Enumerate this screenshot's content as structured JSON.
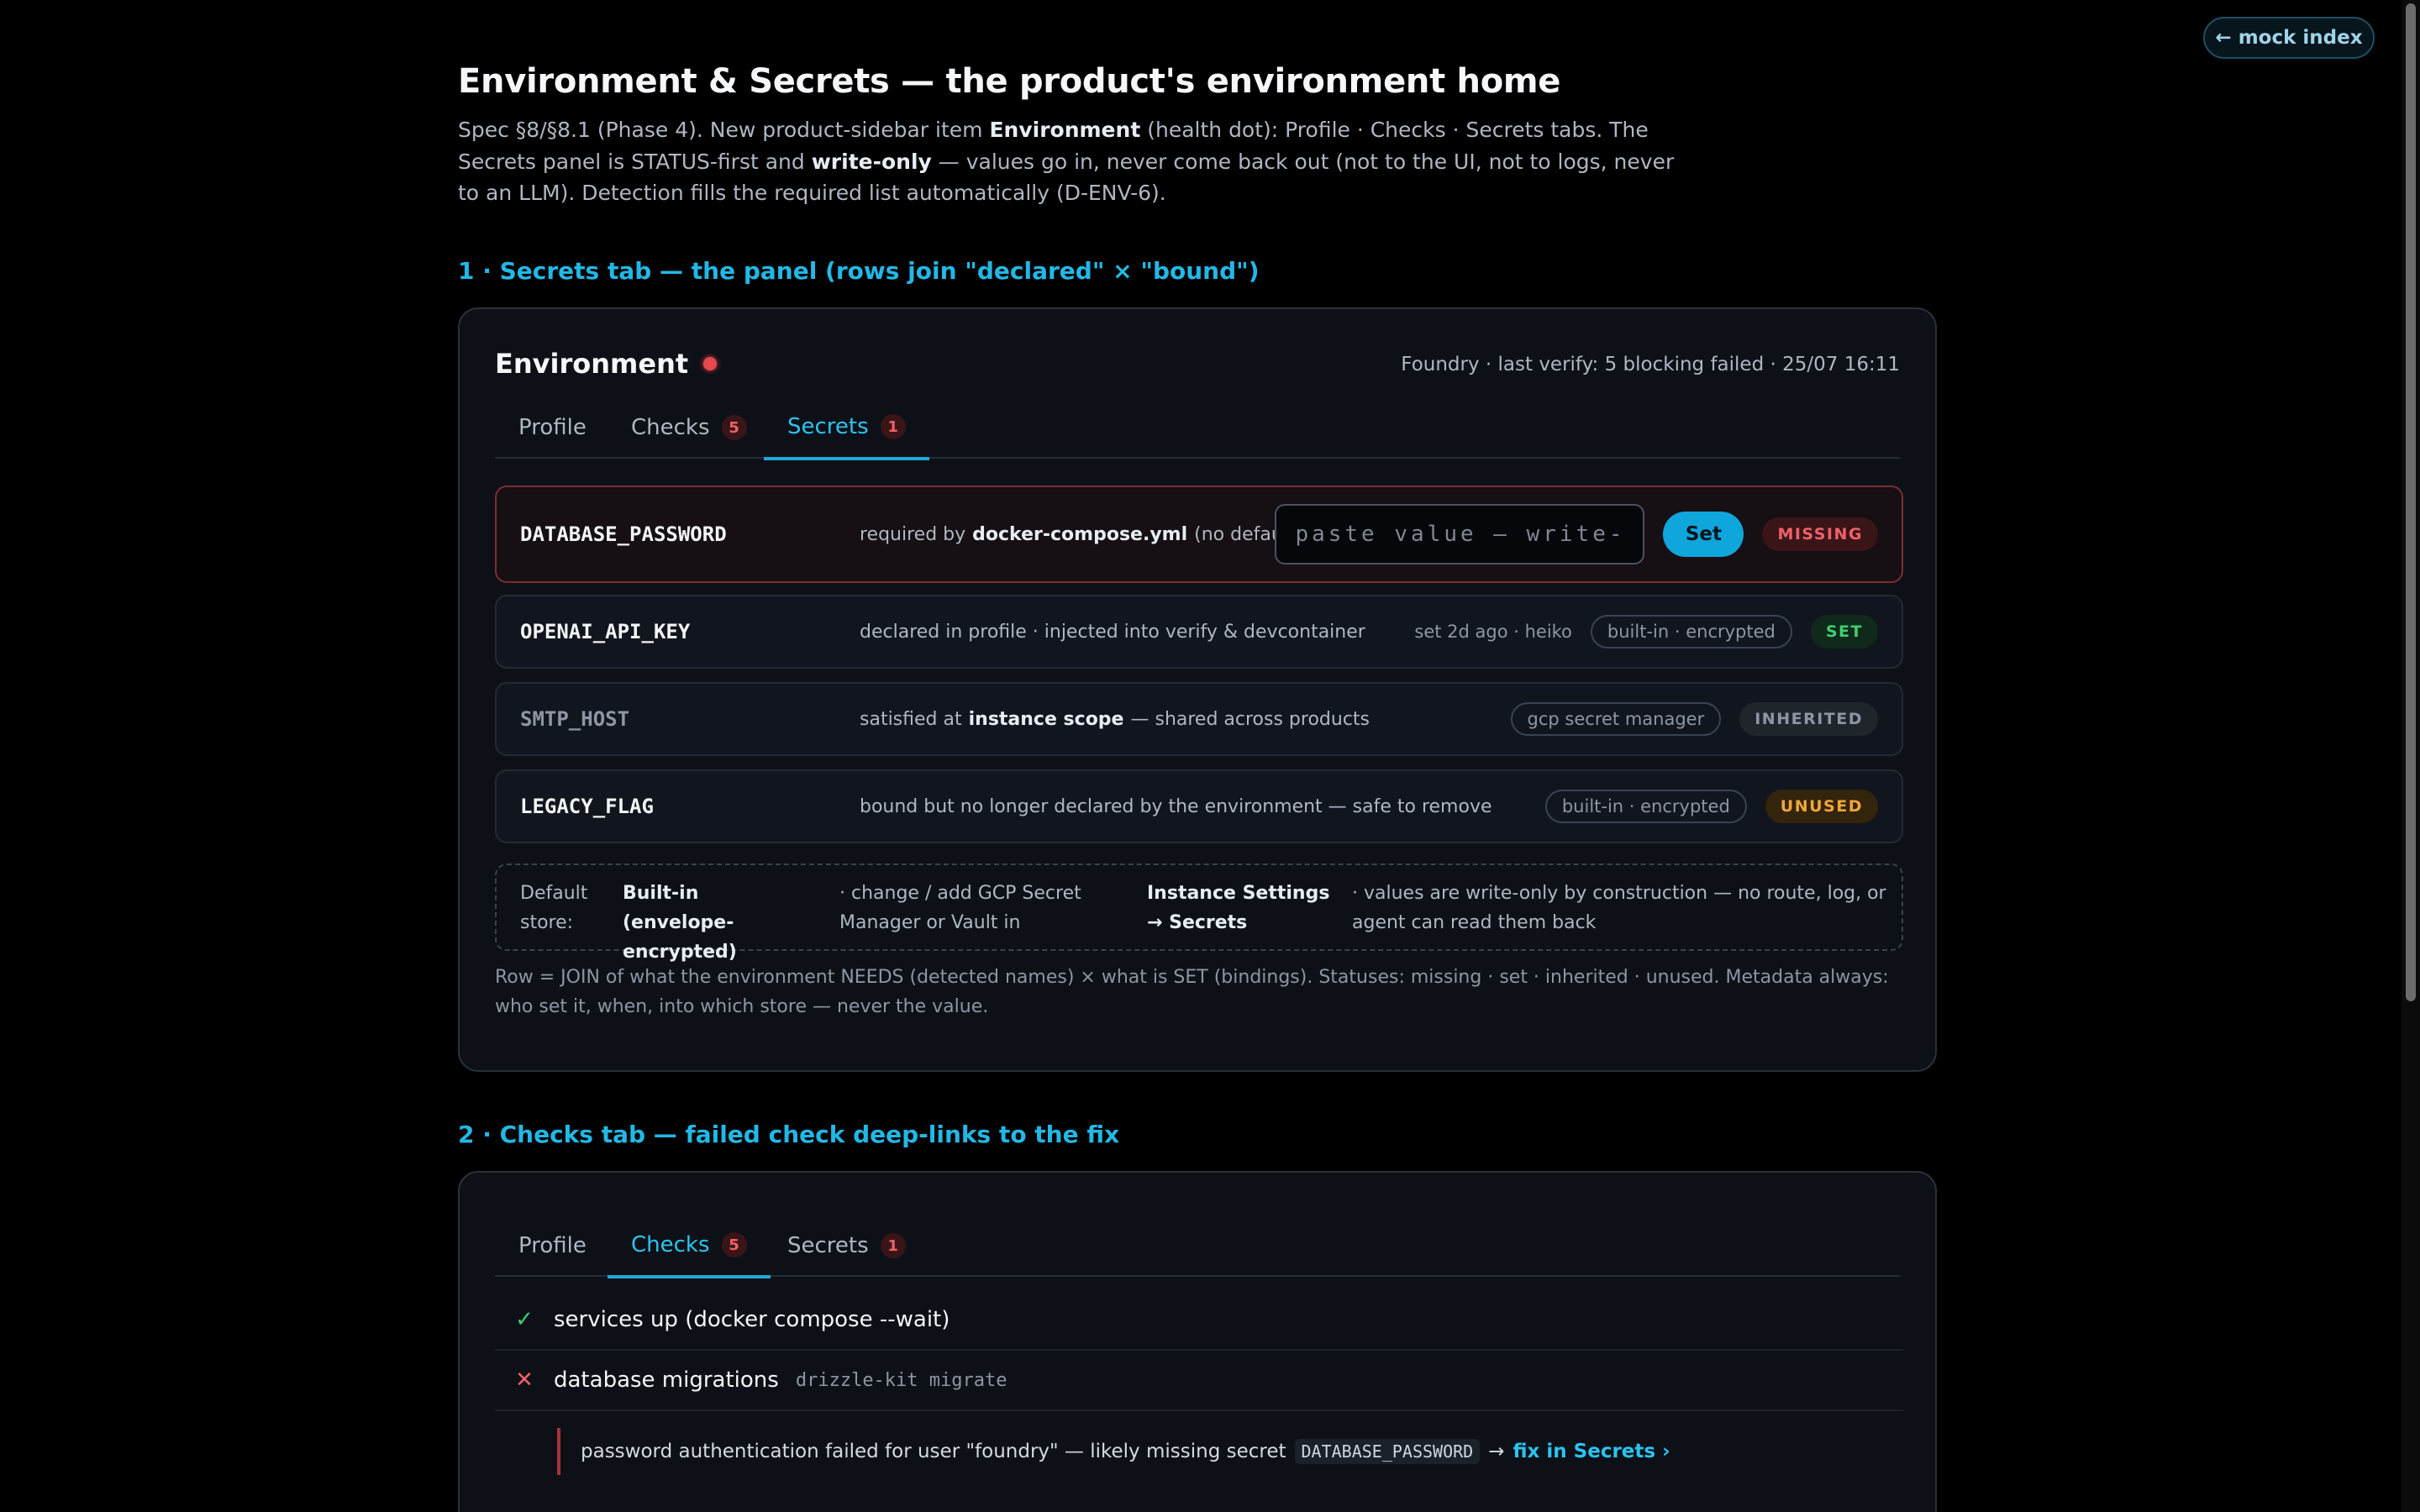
{
  "nav": {
    "mock_index": "← mock index"
  },
  "page": {
    "title": "Environment & Secrets — the product's environment home",
    "intro": {
      "p1": "Spec §8/§8.1 (Phase 4). New product-sidebar item ",
      "b1": "Environment",
      "p2": " (health dot): Profile · Checks · Secrets tabs. The Secrets panel is STATUS-first and ",
      "b2": "write-only",
      "p3": " — values go in, never come back out (not to the UI, not to logs, never to an LLM). Detection fills the required list automatically (D-ENV-6)."
    }
  },
  "sections": {
    "secrets_heading": "1 · Secrets tab — the panel (rows join \"declared\" × \"bound\")",
    "checks_heading": "2 · Checks tab — failed check deep-links to the fix"
  },
  "panel": {
    "title": "Environment",
    "meta": "Foundry · last verify: 5 blocking failed · 25/07 16:11",
    "tabs": [
      {
        "label": "Profile",
        "badge": ""
      },
      {
        "label": "Checks",
        "badge": "5"
      },
      {
        "label": "Secrets",
        "badge": "1"
      }
    ],
    "secrets": [
      {
        "name": "DATABASE_PASSWORD",
        "desc_pre": "required by",
        "desc_bold": "docker-compose.yml",
        "desc_post": "(no default)",
        "input_placeholder": "paste value — write-only",
        "button": "Set",
        "status": "MISSING"
      },
      {
        "name": "OPENAI_API_KEY",
        "desc": "declared in profile · injected into verify & devcontainer",
        "meta": "set 2d ago · heiko",
        "store": "built-in · encrypted",
        "status": "SET"
      },
      {
        "name": "SMTP_HOST",
        "desc_pre": "satisfied at",
        "desc_bold": "instance scope",
        "desc_post": "— shared across products",
        "store": "gcp secret manager",
        "status": "INHERITED"
      },
      {
        "name": "LEGACY_FLAG",
        "desc": "bound but no longer declared by the environment — safe to remove",
        "store": "built-in · encrypted",
        "status": "UNUSED"
      }
    ],
    "store_box": {
      "label": "Default store:",
      "store": "Built-in (envelope-encrypted)",
      "middle": "· change / add GCP Secret Manager or Vault in",
      "link": "Instance Settings → Secrets",
      "tail": "· values are write-only by construction — no route, log, or agent can read them back"
    },
    "note": "Row = JOIN of what the environment NEEDS (detected names) × what is SET (bindings). Statuses: missing · set · inherited · unused. Metadata always: who set it, when, into which store — never the value."
  },
  "checks_panel": {
    "tabs": [
      {
        "label": "Profile",
        "badge": ""
      },
      {
        "label": "Checks",
        "badge": "5"
      },
      {
        "label": "Secrets",
        "badge": "1"
      }
    ],
    "checks": [
      {
        "mark": "✓",
        "label": "services up (docker compose --wait)",
        "cmd": ""
      },
      {
        "mark": "✕",
        "label": "database migrations",
        "cmd": "drizzle-kit migrate"
      }
    ],
    "failure": {
      "text": "password authentication failed for user \"foundry\" — likely missing secret",
      "code": "DATABASE_PASSWORD",
      "arrow": "→",
      "fix": "fix in Secrets ›"
    }
  }
}
